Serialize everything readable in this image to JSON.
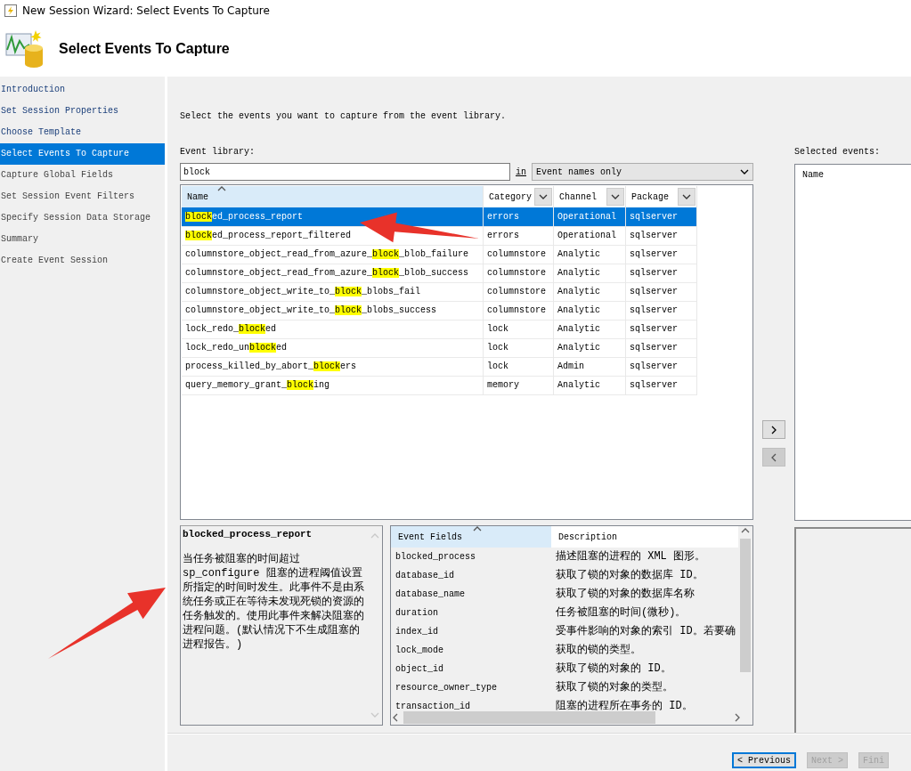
{
  "window": {
    "title": "New Session Wizard: Select Events To Capture"
  },
  "header": {
    "title": "Select Events To Capture"
  },
  "sidebar": {
    "items": [
      {
        "label": "Introduction",
        "selected": false
      },
      {
        "label": "Set Session Properties",
        "selected": false
      },
      {
        "label": "Choose Template",
        "selected": false
      },
      {
        "label": "Select Events To Capture",
        "selected": true
      },
      {
        "label": "Capture Global Fields",
        "selected": false
      },
      {
        "label": "Set Session Event Filters",
        "selected": false
      },
      {
        "label": "Specify Session Data Storage",
        "selected": false
      },
      {
        "label": "Summary",
        "selected": false
      },
      {
        "label": "Create Event Session",
        "selected": false
      }
    ]
  },
  "instructions": "Select the events you want to capture from the event library.",
  "event_library": {
    "label": "Event library:",
    "search": {
      "value": "block"
    },
    "in_label": "in",
    "scope": {
      "value": "Event names only"
    },
    "table": {
      "columns": [
        {
          "label": "Name",
          "sorted": true,
          "filter": false
        },
        {
          "label": "Category",
          "sorted": false,
          "filter": true
        },
        {
          "label": "Channel",
          "sorted": false,
          "filter": true
        },
        {
          "label": "Package",
          "sorted": false,
          "filter": true
        }
      ],
      "rows": [
        {
          "name": {
            "match": "block",
            "after": "ed_process_report"
          },
          "category": "errors",
          "channel": "Operational",
          "package": "sqlserver",
          "selected": true
        },
        {
          "name": {
            "match": "block",
            "after": "ed_process_report_filtered"
          },
          "category": "errors",
          "channel": "Operational",
          "package": "sqlserver",
          "selected": false
        },
        {
          "name": {
            "before": "columnstore_object_read_from_azure_",
            "match": "block",
            "after": "_blob_failure"
          },
          "category": "columnstore",
          "channel": "Analytic",
          "package": "sqlserver",
          "selected": false
        },
        {
          "name": {
            "before": "columnstore_object_read_from_azure_",
            "match": "block",
            "after": "_blob_success"
          },
          "category": "columnstore",
          "channel": "Analytic",
          "package": "sqlserver",
          "selected": false
        },
        {
          "name": {
            "before": "columnstore_object_write_to_",
            "match": "block",
            "after": "_blobs_fail"
          },
          "category": "columnstore",
          "channel": "Analytic",
          "package": "sqlserver",
          "selected": false
        },
        {
          "name": {
            "before": "columnstore_object_write_to_",
            "match": "block",
            "after": "_blobs_success"
          },
          "category": "columnstore",
          "channel": "Analytic",
          "package": "sqlserver",
          "selected": false
        },
        {
          "name": {
            "before": "lock_redo_",
            "match": "block",
            "after": "ed"
          },
          "category": "lock",
          "channel": "Analytic",
          "package": "sqlserver",
          "selected": false
        },
        {
          "name": {
            "before": "lock_redo_un",
            "match": "block",
            "after": "ed"
          },
          "category": "lock",
          "channel": "Analytic",
          "package": "sqlserver",
          "selected": false
        },
        {
          "name": {
            "before": "process_killed_by_abort_",
            "match": "block",
            "after": "ers"
          },
          "category": "lock",
          "channel": "Admin",
          "package": "sqlserver",
          "selected": false
        },
        {
          "name": {
            "before": "query_memory_grant_",
            "match": "block",
            "after": "ing"
          },
          "category": "memory",
          "channel": "Analytic",
          "package": "sqlserver",
          "selected": false
        }
      ]
    }
  },
  "move_buttons": [
    {
      "kind": "add",
      "disabled": false
    },
    {
      "kind": "remove",
      "disabled": true
    }
  ],
  "selected_events": {
    "label": "Selected events:",
    "columns": [
      "Name"
    ]
  },
  "details": {
    "title": "blocked_process_report",
    "description": "当任务被阻塞的时间超过 sp_configure 阻塞的进程阈值设置所指定的时间时发生。此事件不是由系统任务或正在等待未发现死锁的资源的任务触发的。使用此事件来解决阻塞的进程问题。(默认情况下不生成阻塞的进程报告。)"
  },
  "fields_table": {
    "columns": [
      {
        "label": "Event Fields",
        "sorted": true
      },
      {
        "label": "Description",
        "sorted": false
      }
    ],
    "rows": [
      {
        "field": "blocked_process",
        "description": "描述阻塞的进程的 XML 图形。"
      },
      {
        "field": "database_id",
        "description": "获取了锁的对象的数据库 ID。"
      },
      {
        "field": "database_name",
        "description": "获取了锁的对象的数据库名称"
      },
      {
        "field": "duration",
        "description": "任务被阻塞的时间(微秒)。"
      },
      {
        "field": "index_id",
        "description": "受事件影响的对象的索引 ID。若要确"
      },
      {
        "field": "lock_mode",
        "description": "获取的锁的类型。"
      },
      {
        "field": "object_id",
        "description": "获取了锁的对象的 ID。"
      },
      {
        "field": "resource_owner_type",
        "description": "获取了锁的对象的类型。"
      },
      {
        "field": "transaction_id",
        "description": "阻塞的进程所在事务的 ID。"
      }
    ]
  },
  "footer": {
    "buttons": [
      {
        "label": "< Previous",
        "disabled": false,
        "focused": true
      },
      {
        "label": "Next >",
        "disabled": true,
        "focused": false
      },
      {
        "label": "Fini",
        "disabled": true,
        "focused": false
      }
    ]
  }
}
